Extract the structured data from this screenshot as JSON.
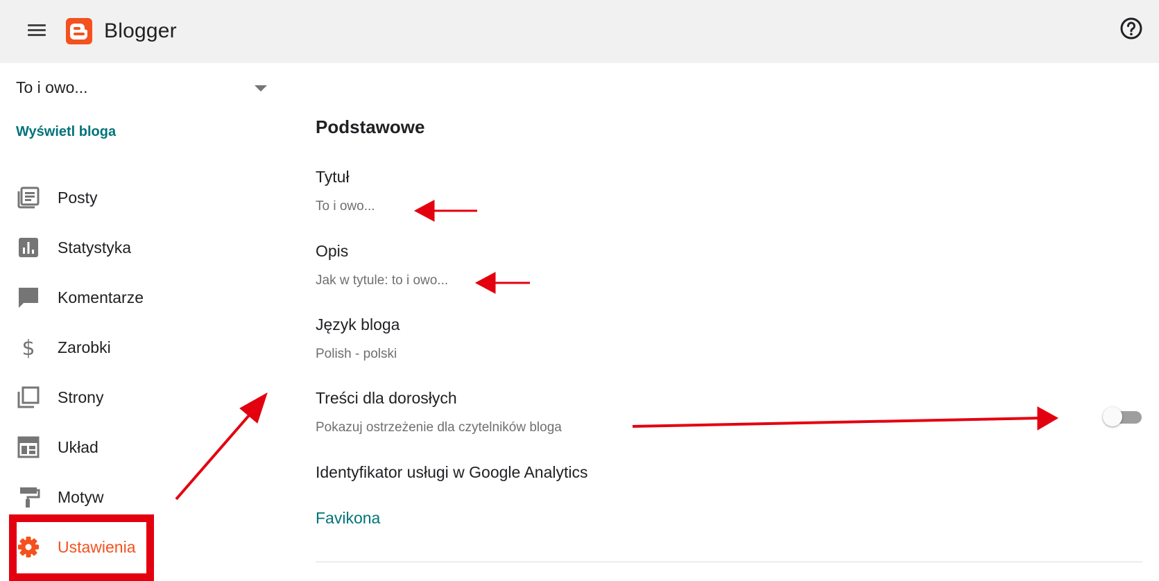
{
  "header": {
    "app_name": "Blogger",
    "menu_icon": "hamburger-menu-icon",
    "help_icon": "help-circle-icon",
    "brand_color": "#f4511e"
  },
  "sidebar": {
    "selected_blog": "To i owo...",
    "view_blog_label": "Wyświetl bloga",
    "items": [
      {
        "label": "Posty",
        "icon": "posts-icon"
      },
      {
        "label": "Statystyka",
        "icon": "stats-icon"
      },
      {
        "label": "Komentarze",
        "icon": "comment-icon"
      },
      {
        "label": "Zarobki",
        "icon": "dollar-icon"
      },
      {
        "label": "Strony",
        "icon": "pages-icon"
      },
      {
        "label": "Układ",
        "icon": "layout-icon"
      },
      {
        "label": "Motyw",
        "icon": "theme-roller-icon"
      },
      {
        "label": "Ustawienia",
        "icon": "gear-icon",
        "active": true
      }
    ]
  },
  "main": {
    "section_title": "Podstawowe",
    "settings": [
      {
        "label": "Tytuł",
        "value": "To i owo..."
      },
      {
        "label": "Opis",
        "value": "Jak w tytule: to i owo..."
      },
      {
        "label": "Język bloga",
        "value": "Polish - polski"
      },
      {
        "label": "Treści dla dorosłych",
        "value": "Pokazuj ostrzeżenie dla czytelników bloga",
        "toggle_on": false
      },
      {
        "label": "Identyfikator usługi w Google Analytics"
      }
    ],
    "favicon_label": "Favikona"
  },
  "colors": {
    "accent_teal": "#00737a",
    "active_orange": "#f4511e",
    "annotation_red": "#e3000f",
    "topbar_bg": "#f1f1f1"
  }
}
